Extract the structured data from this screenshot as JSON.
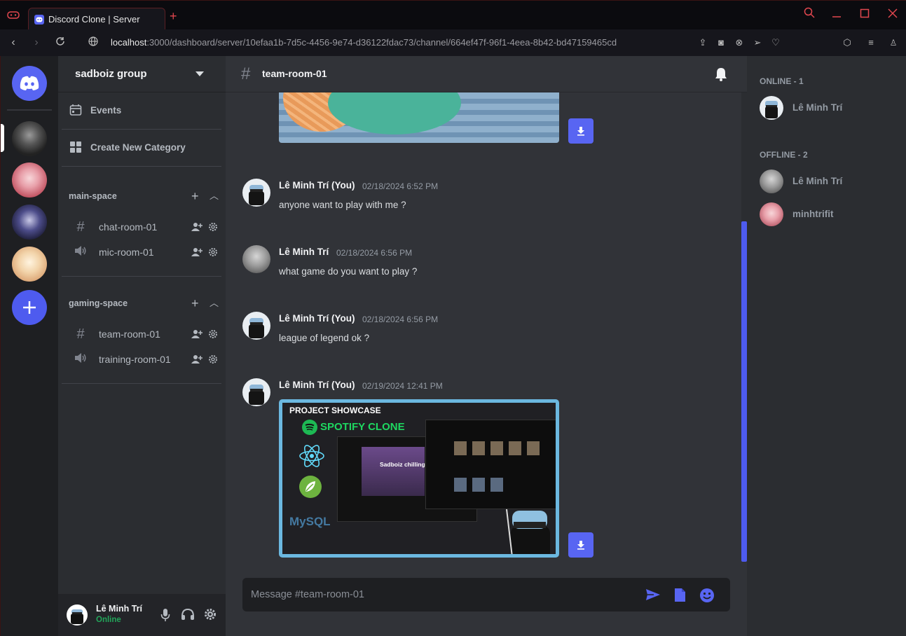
{
  "browser": {
    "tab_title": "Discord Clone | Server",
    "new_tab_label": "+",
    "url_host": "localhost",
    "url_rest": ":3000/dashboard/server/10efaa1b-7d5c-4456-9e74-d36122fdac73/channel/664ef47f-96f1-4eea-8b42-bd47159465cd"
  },
  "server": {
    "name": "sadboiz group",
    "events_label": "Events",
    "create_category_label": "Create New Category"
  },
  "categories": [
    {
      "name": "main-space",
      "channels": [
        {
          "name": "chat-room-01",
          "type": "text"
        },
        {
          "name": "mic-room-01",
          "type": "voice"
        }
      ]
    },
    {
      "name": "gaming-space",
      "channels": [
        {
          "name": "team-room-01",
          "type": "text"
        },
        {
          "name": "training-room-01",
          "type": "voice"
        }
      ]
    }
  ],
  "user": {
    "name": "Lê Minh Trí",
    "status": "Online"
  },
  "channel": {
    "name": "team-room-01"
  },
  "messages": [
    {
      "author": "Lê Minh Trí (You)",
      "time": "02/18/2024 6:52 PM",
      "text": "anyone want to play with me ?"
    },
    {
      "author": "Lê Minh Trí",
      "time": "02/18/2024 6:56 PM",
      "text": "what game do you want to play ?"
    },
    {
      "author": "Lê Minh Trí (You)",
      "time": "02/18/2024 6:56 PM",
      "text": "league of legend ok ?"
    },
    {
      "author": "Lê Minh Trí (You)",
      "time": "02/19/2024 12:41 PM",
      "text": ""
    }
  ],
  "showcase": {
    "heading": "PROJECT SHOWCASE",
    "app": "SPOTIFY CLONE",
    "playlist": "Sadboiz chilling",
    "db_logo": "MySQL"
  },
  "composer": {
    "placeholder": "Message #team-room-01"
  },
  "members": {
    "online_header": "ONLINE - 1",
    "offline_header": "OFFLINE - 2",
    "online": [
      {
        "name": "Lê Minh Trí"
      }
    ],
    "offline": [
      {
        "name": "Lê Minh Trí"
      },
      {
        "name": "minhtrifit"
      }
    ]
  },
  "colors": {
    "accent": "#5865f2",
    "online": "#23a55a",
    "showcase_border": "#6bb8e0"
  }
}
